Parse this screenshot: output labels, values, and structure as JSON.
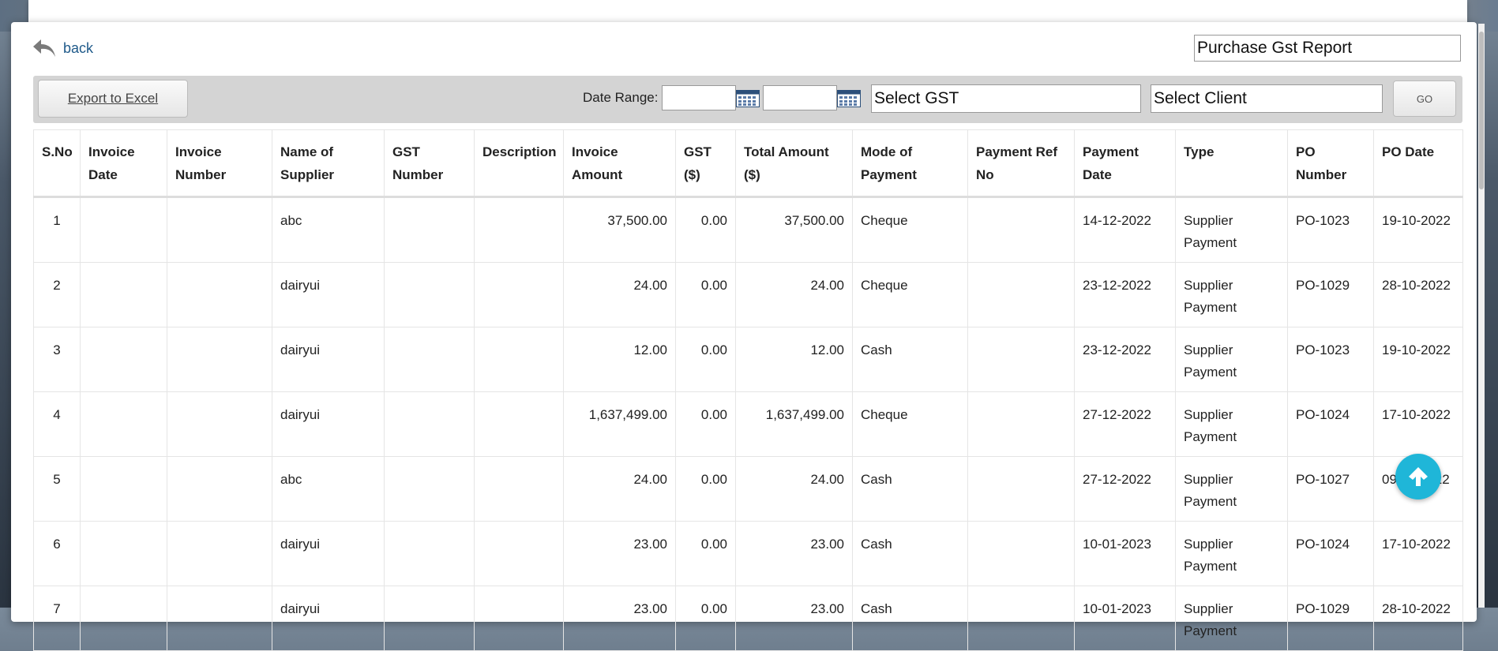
{
  "nav": {
    "back_label": "back"
  },
  "report_title": "Purchase Gst Report",
  "toolbar": {
    "export_label": "Export to Excel",
    "date_range_label": "Date Range:",
    "date_from": "",
    "date_to": "",
    "gst_select": "Select GST",
    "client_select": "Select Client",
    "go_label": "GO"
  },
  "table": {
    "headers": [
      "S.No",
      "Invoice Date",
      "Invoice Number",
      "Name of Supplier",
      "GST Number",
      "Description",
      "Invoice Amount",
      "GST ($)",
      "Total Amount ($)",
      "Mode of Payment",
      "Payment Ref No",
      "Payment Date",
      "Type",
      "PO Number",
      "PO Date"
    ],
    "rows": [
      [
        "1",
        "",
        "",
        "abc",
        "",
        "",
        "37,500.00",
        "0.00",
        "37,500.00",
        "Cheque",
        "",
        "14-12-2022",
        "Supplier Payment",
        "PO-1023",
        "19-10-2022"
      ],
      [
        "2",
        "",
        "",
        "dairyui",
        "",
        "",
        "24.00",
        "0.00",
        "24.00",
        "Cheque",
        "",
        "23-12-2022",
        "Supplier Payment",
        "PO-1029",
        "28-10-2022"
      ],
      [
        "3",
        "",
        "",
        "dairyui",
        "",
        "",
        "12.00",
        "0.00",
        "12.00",
        "Cash",
        "",
        "23-12-2022",
        "Supplier Payment",
        "PO-1023",
        "19-10-2022"
      ],
      [
        "4",
        "",
        "",
        "dairyui",
        "",
        "",
        "1,637,499.00",
        "0.00",
        "1,637,499.00",
        "Cheque",
        "",
        "27-12-2022",
        "Supplier Payment",
        "PO-1024",
        "17-10-2022"
      ],
      [
        "5",
        "",
        "",
        "abc",
        "",
        "",
        "24.00",
        "0.00",
        "24.00",
        "Cash",
        "",
        "27-12-2022",
        "Supplier Payment",
        "PO-1027",
        "09-11-2022"
      ],
      [
        "6",
        "",
        "",
        "dairyui",
        "",
        "",
        "23.00",
        "0.00",
        "23.00",
        "Cash",
        "",
        "10-01-2023",
        "Supplier Payment",
        "PO-1024",
        "17-10-2022"
      ],
      [
        "7",
        "",
        "",
        "dairyui",
        "",
        "",
        "23.00",
        "0.00",
        "23.00",
        "Cash",
        "",
        "10-01-2023",
        "Supplier Payment",
        "PO-1029",
        "28-10-2022"
      ]
    ]
  },
  "icons": {
    "back": "back-arrow-icon",
    "calendar": "calendar-icon",
    "scroll_top": "arrow-up-icon"
  },
  "colors": {
    "accent": "#1fb6d8",
    "link": "#1f5a8a",
    "toolbar_bg": "#d4d4d4"
  }
}
